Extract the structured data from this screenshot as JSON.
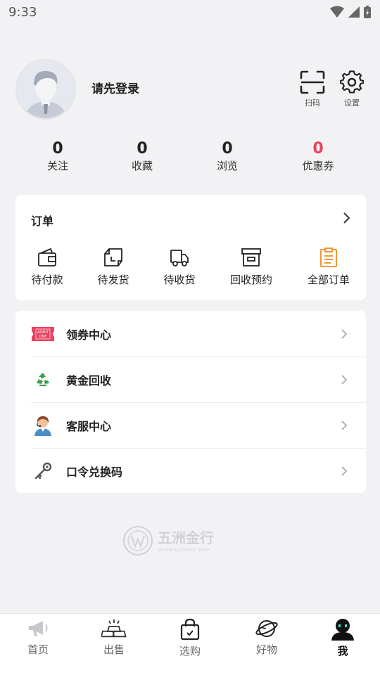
{
  "status_bar": {
    "time": "9:33"
  },
  "profile": {
    "login_prompt": "请先登录",
    "scan_label": "扫码",
    "settings_label": "设置"
  },
  "stats": [
    {
      "value": "0",
      "label": "关注",
      "color": "#222222"
    },
    {
      "value": "0",
      "label": "收藏",
      "color": "#222222"
    },
    {
      "value": "0",
      "label": "浏览",
      "color": "#222222"
    },
    {
      "value": "0",
      "label": "优惠券",
      "color": "#e8425d"
    }
  ],
  "orders": {
    "title": "订单",
    "items": [
      {
        "label": "待付款",
        "icon": "wallet-icon"
      },
      {
        "label": "待发货",
        "icon": "package-icon"
      },
      {
        "label": "待收货",
        "icon": "truck-icon"
      },
      {
        "label": "回收预约",
        "icon": "archive-box-icon"
      },
      {
        "label": "全部订单",
        "icon": "clipboard-list-icon"
      }
    ]
  },
  "menu": [
    {
      "label": "领券中心",
      "icon": "ticket-icon"
    },
    {
      "label": "黄金回收",
      "icon": "recycle-icon"
    },
    {
      "label": "客服中心",
      "icon": "customer-service-icon"
    },
    {
      "label": "口令兑换码",
      "icon": "key-icon"
    }
  ],
  "brand": {
    "name_cn": "五洲金行",
    "name_en": "WUZHOU JEWELS' SHOP"
  },
  "tabbar": [
    {
      "label": "首页",
      "icon": "megaphone-icon",
      "active": false
    },
    {
      "label": "出售",
      "icon": "gold-bars-icon",
      "active": false
    },
    {
      "label": "选购",
      "icon": "shopping-bag-icon",
      "active": false
    },
    {
      "label": "好物",
      "icon": "planet-icon",
      "active": false
    },
    {
      "label": "我",
      "icon": "user-robot-icon",
      "active": true
    }
  ],
  "colors": {
    "accent_red": "#e8425d",
    "accent_orange": "#f08a24",
    "active_tab": "#111111"
  }
}
